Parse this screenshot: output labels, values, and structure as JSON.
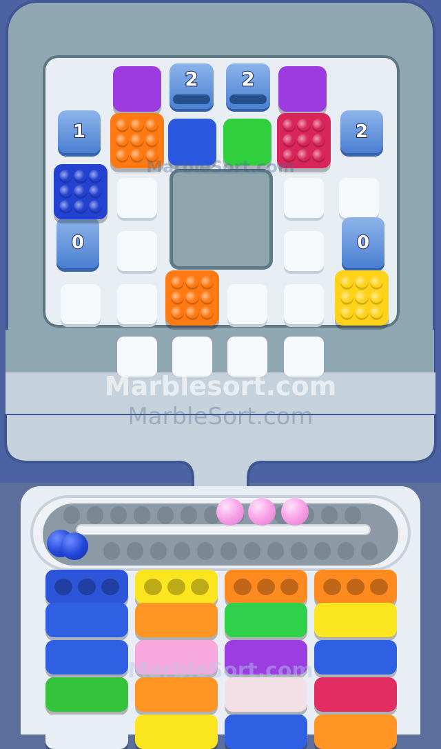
{
  "board": {
    "holders": [
      {
        "count": "1",
        "side": "left",
        "row": 1
      },
      {
        "count": "2",
        "side": "right",
        "row": 1
      },
      {
        "count": "0",
        "side": "left",
        "row": 3
      },
      {
        "count": "0",
        "side": "right",
        "row": 3
      }
    ],
    "pipes": [
      {
        "count": "2"
      },
      {
        "count": "2"
      }
    ],
    "colored_blocks": [
      {
        "color": "#9c3be0"
      },
      {
        "color": "#9c3be0"
      },
      {
        "color": "#2a59e0"
      },
      {
        "color": "#2fcf3e"
      }
    ],
    "peg_blocks": [
      {
        "color": "#ff7a12",
        "position": "top-row-left"
      },
      {
        "color": "#d8265a",
        "position": "top-row-right"
      },
      {
        "color": "#2342d2",
        "position": "left"
      },
      {
        "color": "#ff7a12",
        "position": "bottom-middle"
      },
      {
        "color": "#ffd31a",
        "position": "right"
      }
    ]
  },
  "watermarks": {
    "line1": "Marblesort.com",
    "line2": "MarbleSort.com",
    "small_top": "MarbleSort.com",
    "small_bottom": "MarbleSort.com"
  },
  "track": {
    "pink_marbles": 3,
    "blue_marbles": 2,
    "marble_colors": {
      "pink": "#f7a3e9",
      "blue": "#2047d6"
    }
  },
  "crates": {
    "columns": [
      [
        "#2c55d9",
        "#2f5fe3",
        "#2f5fe3",
        "#35c33c",
        "#e8eef5"
      ],
      [
        "#fbe51f",
        "#ff9624",
        "#f7a9dd",
        "#ff9624",
        "#fbe51f"
      ],
      [
        "#ff8a1f",
        "#2fd04a",
        "#9b3de0",
        "#f3dfe6",
        "#2f5fe3"
      ],
      [
        "#ff8a1f",
        "#fbe51f",
        "#2f5fe3",
        "#e22e63",
        "#ff9624"
      ]
    ]
  }
}
